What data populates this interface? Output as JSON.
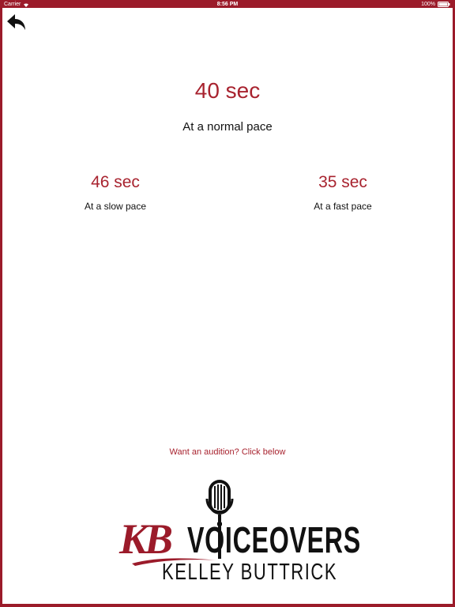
{
  "status_bar": {
    "carrier": "Carrier",
    "time": "8:56 PM",
    "battery": "100%"
  },
  "nav": {
    "back_icon": "back-arrow-icon"
  },
  "normal": {
    "time": "40 sec",
    "label": "At a normal pace"
  },
  "slow": {
    "time": "46 sec",
    "label": "At a slow pace"
  },
  "fast": {
    "time": "35 sec",
    "label": "At a fast pace"
  },
  "audition": {
    "link_text": "Want an audition? Click below"
  },
  "logo": {
    "initials": "KB",
    "word": "VOICEOVERS",
    "name": "KELLEY BUTTRICK"
  },
  "colors": {
    "brand": "#9b1b2a",
    "accent_text": "#a8232f"
  }
}
